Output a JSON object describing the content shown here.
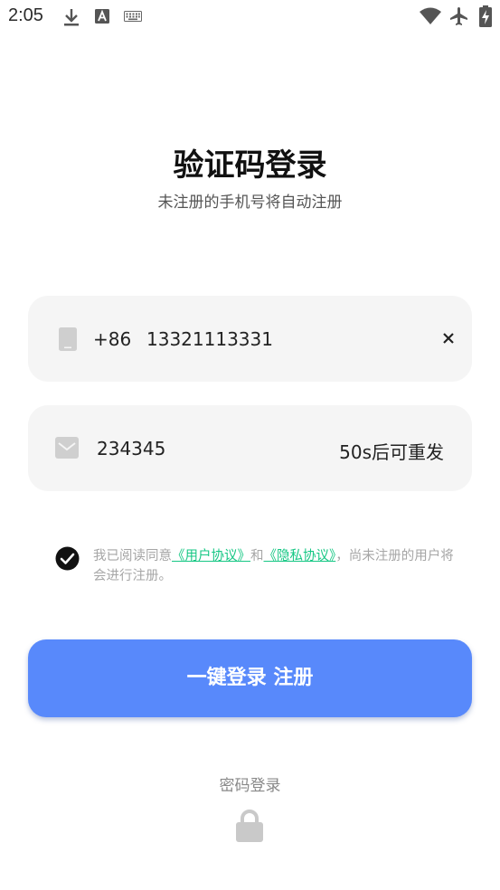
{
  "status_bar": {
    "time": "2:05",
    "icons": [
      "download-icon",
      "font-icon",
      "keyboard-icon",
      "wifi-icon",
      "airplane-icon",
      "battery-charging-icon"
    ]
  },
  "header": {
    "title": "验证码登录",
    "subtitle": "未注册的手机号将自动注册"
  },
  "phone_field": {
    "icon": "phone-icon",
    "country_code": "+86",
    "value": "13321113331",
    "clear_icon": "close-icon"
  },
  "code_field": {
    "icon": "mail-icon",
    "value": "234345",
    "resend_label": "50s后可重发"
  },
  "agreement": {
    "checked": true,
    "prefix": "我已阅读同意",
    "user_agreement": "《用户协议》",
    "and": "和",
    "privacy_agreement": "《隐私协议》",
    "suffix": "，尚未注册的用户将会进行注册。"
  },
  "login_button": {
    "label": "一键登录 注册"
  },
  "password_login": {
    "label": "密码登录",
    "icon": "lock-icon"
  },
  "colors": {
    "primary": "#5889fb",
    "link": "#16c784",
    "field_bg": "#f5f5f5"
  }
}
